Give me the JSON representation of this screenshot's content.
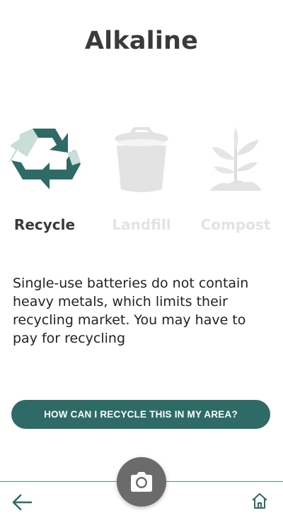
{
  "title": "Alkaline",
  "options": [
    {
      "label": "Recycle",
      "icon": "recycle-icon",
      "active": true
    },
    {
      "label": "Landfill",
      "icon": "trash-bin-icon",
      "active": false
    },
    {
      "label": "Compost",
      "icon": "plant-sprout-icon",
      "active": false
    }
  ],
  "description": "Single-use batteries do not contain heavy metals, which limits their recycling market. You may have to pay for recycling",
  "cta_label": "HOW CAN I RECYCLE THIS IN MY AREA?",
  "nav": {
    "back_icon": "arrow-left-icon",
    "camera_icon": "camera-icon",
    "home_icon": "home-icon"
  },
  "colors": {
    "accent": "#2e6b66",
    "accent_light": "#c9ddd9",
    "inactive": "#e3e3e3",
    "camera_button": "#6b6b6b"
  }
}
